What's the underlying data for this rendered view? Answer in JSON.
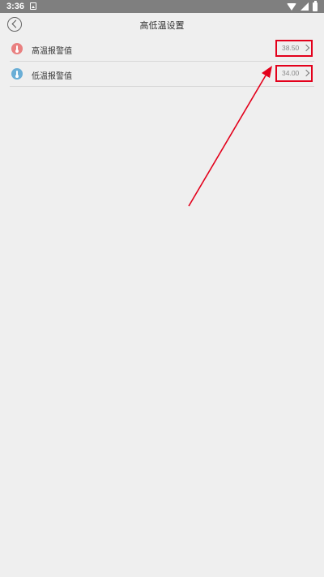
{
  "status_bar": {
    "time": "3:36",
    "icons": [
      "notification-icon",
      "wifi-icon",
      "signal-icon",
      "battery-icon"
    ]
  },
  "header": {
    "title": "高低温设置",
    "back_icon": "back-arrow-icon"
  },
  "settings": [
    {
      "label": "高温报警值",
      "value": "38.50",
      "icon": "thermometer-high-icon",
      "icon_color": "#e98080"
    },
    {
      "label": "低温报警值",
      "value": "34.00",
      "icon": "thermometer-low-icon",
      "icon_color": "#6aaed6"
    }
  ],
  "colors": {
    "annotation": "#e3001b",
    "background": "#efefef"
  }
}
